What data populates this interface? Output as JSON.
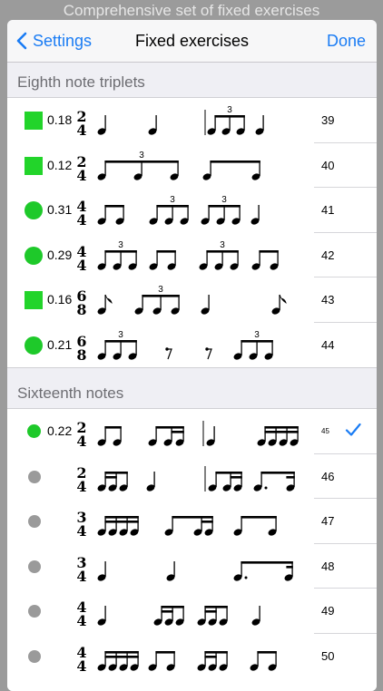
{
  "banner": "Comprehensive set of fixed exercises",
  "nav": {
    "back_label": "Settings",
    "title": "Fixed exercises",
    "done_label": "Done"
  },
  "colors": {
    "accent": "#1a7cf4",
    "progress_green": "#22d42a",
    "inactive_gray": "#9a9a9a"
  },
  "sections": [
    {
      "header": "Eighth note triplets",
      "rows": [
        {
          "indicator": "square",
          "score": "0.18",
          "time": [
            "2",
            "4"
          ],
          "number": "39"
        },
        {
          "indicator": "square",
          "score": "0.12",
          "time": [
            "2",
            "4"
          ],
          "number": "40"
        },
        {
          "indicator": "circle",
          "score": "0.31",
          "time": [
            "4",
            "4"
          ],
          "number": "41"
        },
        {
          "indicator": "circle",
          "score": "0.29",
          "time": [
            "4",
            "4"
          ],
          "number": "42"
        },
        {
          "indicator": "square",
          "score": "0.16",
          "time": [
            "6",
            "8"
          ],
          "number": "43"
        },
        {
          "indicator": "circle",
          "score": "0.21",
          "time": [
            "6",
            "8"
          ],
          "number": "44"
        }
      ]
    },
    {
      "header": "Sixteenth notes",
      "rows": [
        {
          "indicator": "circle-small",
          "score": "0.22",
          "time": [
            "2",
            "4"
          ],
          "number": "45",
          "selected": true
        },
        {
          "indicator": "gray",
          "score": "",
          "time": [
            "2",
            "4"
          ],
          "number": "46"
        },
        {
          "indicator": "gray",
          "score": "",
          "time": [
            "3",
            "4"
          ],
          "number": "47"
        },
        {
          "indicator": "gray",
          "score": "",
          "time": [
            "3",
            "4"
          ],
          "number": "48"
        },
        {
          "indicator": "gray",
          "score": "",
          "time": [
            "4",
            "4"
          ],
          "number": "49"
        },
        {
          "indicator": "gray",
          "score": "",
          "time": [
            "4",
            "4"
          ],
          "number": "50"
        }
      ]
    }
  ],
  "tuplet_label": "3"
}
